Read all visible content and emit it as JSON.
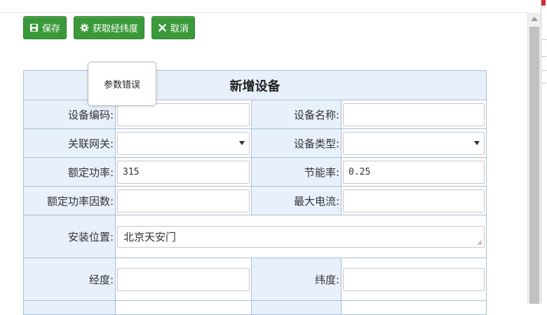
{
  "toolbar": {
    "save_label": "保存",
    "get_coords_label": "获取经纬度",
    "cancel_label": "取消"
  },
  "tooltip": {
    "text": "参数错误"
  },
  "form": {
    "title": "新增设备",
    "device_code": {
      "label": "设备编码:",
      "value": ""
    },
    "device_name": {
      "label": "设备名称:",
      "value": ""
    },
    "gateway": {
      "label": "关联网关:",
      "value": ""
    },
    "device_type": {
      "label": "设备类型:",
      "value": ""
    },
    "rated_power": {
      "label": "额定功率:",
      "value": "315"
    },
    "saving_rate": {
      "label": "节能率:",
      "value": "0.25"
    },
    "power_factor": {
      "label": "额定功率因数:",
      "value": ""
    },
    "max_current": {
      "label": "最大电流:",
      "value": ""
    },
    "location": {
      "label": "安装位置:",
      "value": "北京天安门"
    },
    "longitude": {
      "label": "经度:",
      "value": ""
    },
    "latitude": {
      "label": "纬度:",
      "value": ""
    }
  },
  "colors": {
    "button_green": "#3a9a3a",
    "label_bg": "#e8f0fb",
    "border": "#a9bfd6"
  }
}
